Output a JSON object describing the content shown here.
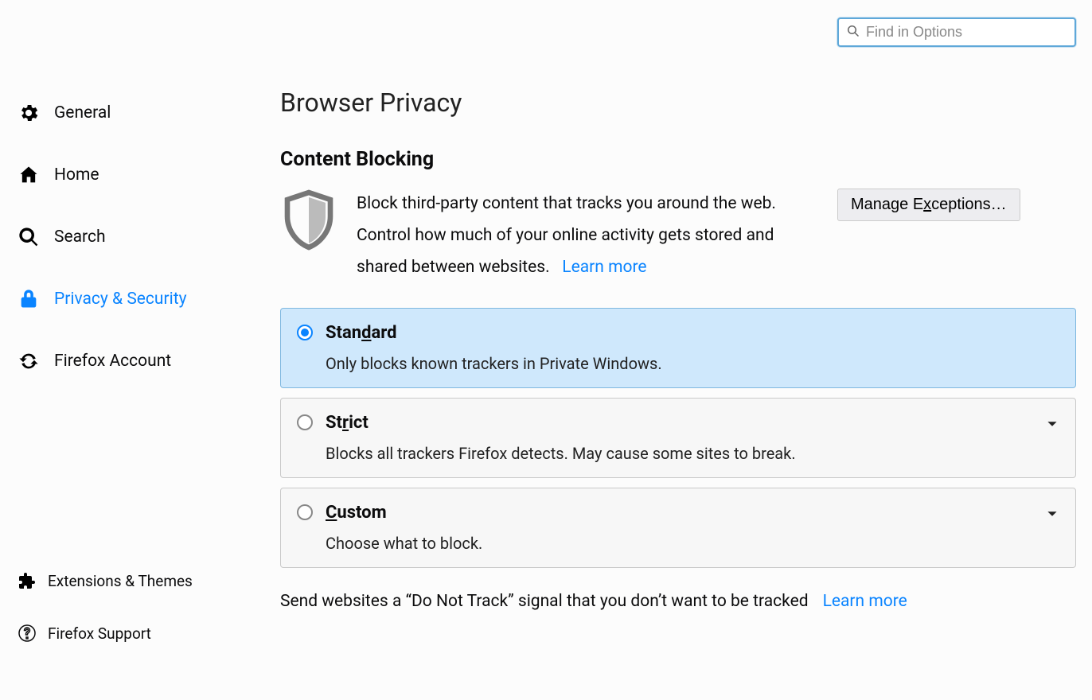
{
  "search": {
    "placeholder": "Find in Options"
  },
  "sidebar": {
    "items": [
      {
        "label": "General"
      },
      {
        "label": "Home"
      },
      {
        "label": "Search"
      },
      {
        "label": "Privacy & Security"
      },
      {
        "label": "Firefox Account"
      }
    ]
  },
  "sidebar_bottom": {
    "items": [
      {
        "label": "Extensions & Themes"
      },
      {
        "label": "Firefox Support"
      }
    ]
  },
  "page": {
    "title": "Browser Privacy",
    "section_title": "Content Blocking",
    "intro_text": "Block third-party content that tracks you around the web. Control how much of your online activity gets stored and shared between websites.",
    "learn_more": "Learn more",
    "manage_exceptions_pre": "Manage E",
    "manage_exceptions_key": "x",
    "manage_exceptions_post": "ceptions…"
  },
  "options": {
    "standard": {
      "label_pre": "Stan",
      "label_key": "d",
      "label_post": "ard",
      "desc": "Only blocks known trackers in Private Windows."
    },
    "strict": {
      "label_pre": "St",
      "label_key": "r",
      "label_post": "ict",
      "desc": "Blocks all trackers Firefox detects. May cause some sites to break."
    },
    "custom": {
      "label_key": "C",
      "label_post": "ustom",
      "desc": "Choose what to block."
    }
  },
  "dnt": {
    "text": "Send websites a “Do Not Track” signal that you don’t want to be tracked",
    "learn_more": "Learn more"
  }
}
